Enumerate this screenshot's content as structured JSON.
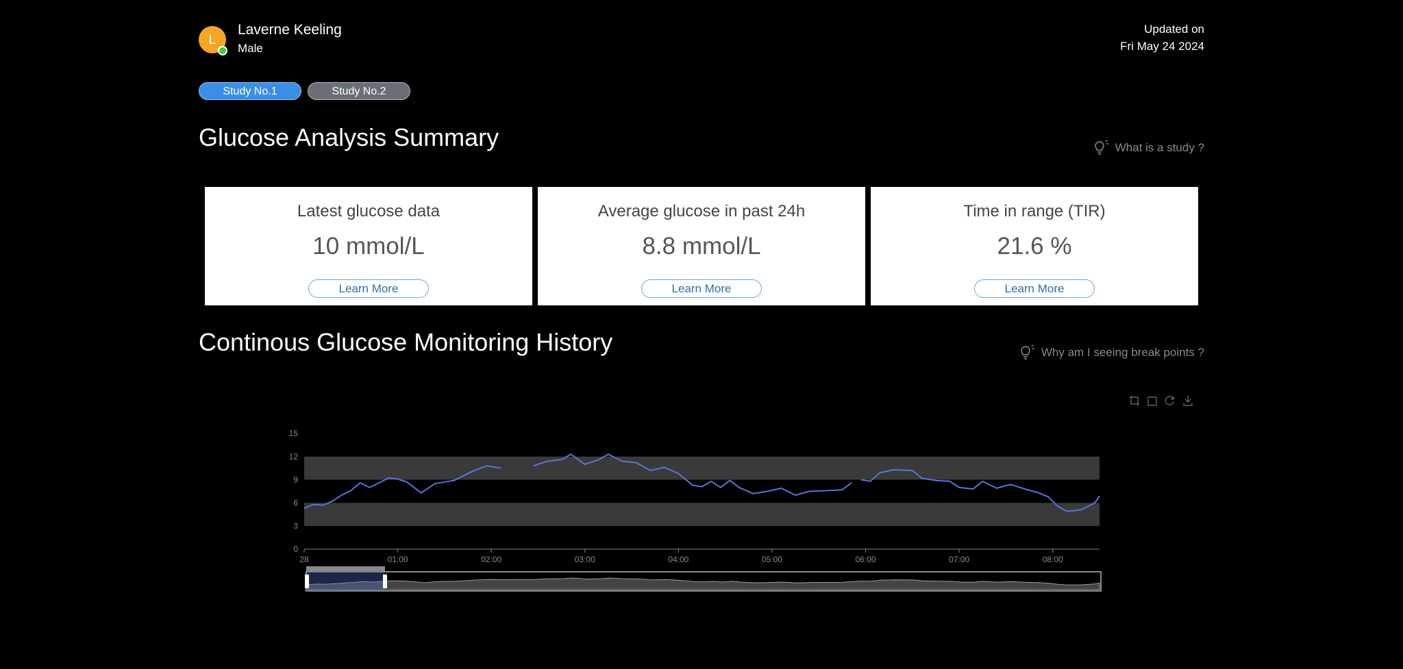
{
  "patient": {
    "initial": "L",
    "name": "Laverne Keeling",
    "gender": "Male"
  },
  "updated": {
    "label": "Updated on",
    "date": "Fri May 24 2024"
  },
  "study_tabs": [
    {
      "label": "Study No.1",
      "active": true
    },
    {
      "label": "Study No.2",
      "active": false
    }
  ],
  "summary": {
    "title": "Glucose Analysis Summary",
    "hint": "What is a study ?",
    "cards": [
      {
        "title": "Latest glucose data",
        "value": "10 mmol/L",
        "button": "Learn More"
      },
      {
        "title": "Average glucose in past 24h",
        "value": "8.8 mmol/L",
        "button": "Learn More"
      },
      {
        "title": "Time in range (TIR)",
        "value": "21.6 %",
        "button": "Learn More"
      }
    ]
  },
  "history": {
    "title": "Continous Glucose Monitoring History",
    "hint": "Why am I seeing break points ?"
  },
  "toolbox_icons": [
    "zoom-select-icon",
    "zoom-reset-icon",
    "restore-icon",
    "download-icon"
  ],
  "colors": {
    "accent": "#3a8ee6",
    "line": "#5b73dd",
    "band": "#3a3a3a",
    "avatar": "#f5a623"
  },
  "chart_data": {
    "type": "line",
    "x_unit": "hour",
    "x_ticks": [
      "28",
      "01:00",
      "02:00",
      "03:00",
      "04:00",
      "05:00",
      "06:00",
      "07:00",
      "08:00"
    ],
    "y_ticks": [
      "0",
      "3",
      "6",
      "9",
      "12",
      "15"
    ],
    "ylim": [
      0,
      15
    ],
    "xlim": [
      0,
      8.5
    ],
    "bands": [
      {
        "from": 3,
        "to": 6
      },
      {
        "from": 9,
        "to": 12
      }
    ],
    "series": [
      {
        "segments": [
          [
            [
              0.0,
              5.3
            ],
            [
              0.1,
              5.8
            ],
            [
              0.2,
              5.7
            ],
            [
              0.3,
              6.2
            ],
            [
              0.4,
              7.0
            ],
            [
              0.5,
              7.6
            ],
            [
              0.6,
              8.6
            ],
            [
              0.7,
              8.0
            ],
            [
              0.8,
              8.6
            ],
            [
              0.9,
              9.2
            ],
            [
              1.0,
              9.1
            ],
            [
              1.1,
              8.7
            ],
            [
              1.25,
              7.3
            ],
            [
              1.4,
              8.5
            ],
            [
              1.6,
              8.9
            ],
            [
              1.8,
              10.1
            ],
            [
              1.95,
              10.8
            ],
            [
              2.1,
              10.5
            ]
          ],
          [
            [
              2.45,
              10.8
            ],
            [
              2.6,
              11.4
            ],
            [
              2.75,
              11.6
            ],
            [
              2.85,
              12.3
            ],
            [
              3.0,
              11.0
            ],
            [
              3.15,
              11.6
            ],
            [
              3.25,
              12.3
            ],
            [
              3.4,
              11.4
            ],
            [
              3.55,
              11.2
            ],
            [
              3.7,
              10.2
            ],
            [
              3.85,
              10.6
            ],
            [
              4.0,
              9.8
            ],
            [
              4.15,
              8.3
            ],
            [
              4.25,
              8.1
            ],
            [
              4.35,
              8.8
            ],
            [
              4.45,
              8.0
            ],
            [
              4.55,
              8.9
            ],
            [
              4.65,
              8.0
            ],
            [
              4.8,
              7.2
            ],
            [
              4.95,
              7.5
            ],
            [
              5.1,
              7.9
            ],
            [
              5.25,
              7.0
            ],
            [
              5.4,
              7.5
            ],
            [
              5.6,
              7.6
            ],
            [
              5.75,
              7.7
            ],
            [
              5.85,
              8.6
            ]
          ],
          [
            [
              5.95,
              9.0
            ],
            [
              6.05,
              8.8
            ],
            [
              6.15,
              9.9
            ],
            [
              6.3,
              10.3
            ],
            [
              6.5,
              10.2
            ],
            [
              6.6,
              9.2
            ],
            [
              6.75,
              8.9
            ],
            [
              6.9,
              8.8
            ],
            [
              7.0,
              8.0
            ],
            [
              7.15,
              7.8
            ],
            [
              7.25,
              8.8
            ],
            [
              7.4,
              7.9
            ],
            [
              7.55,
              8.4
            ],
            [
              7.7,
              7.8
            ],
            [
              7.85,
              7.3
            ],
            [
              7.95,
              6.8
            ],
            [
              8.05,
              5.6
            ],
            [
              8.15,
              4.9
            ],
            [
              8.3,
              5.1
            ],
            [
              8.45,
              6.0
            ],
            [
              8.5,
              6.9
            ]
          ]
        ]
      }
    ]
  }
}
